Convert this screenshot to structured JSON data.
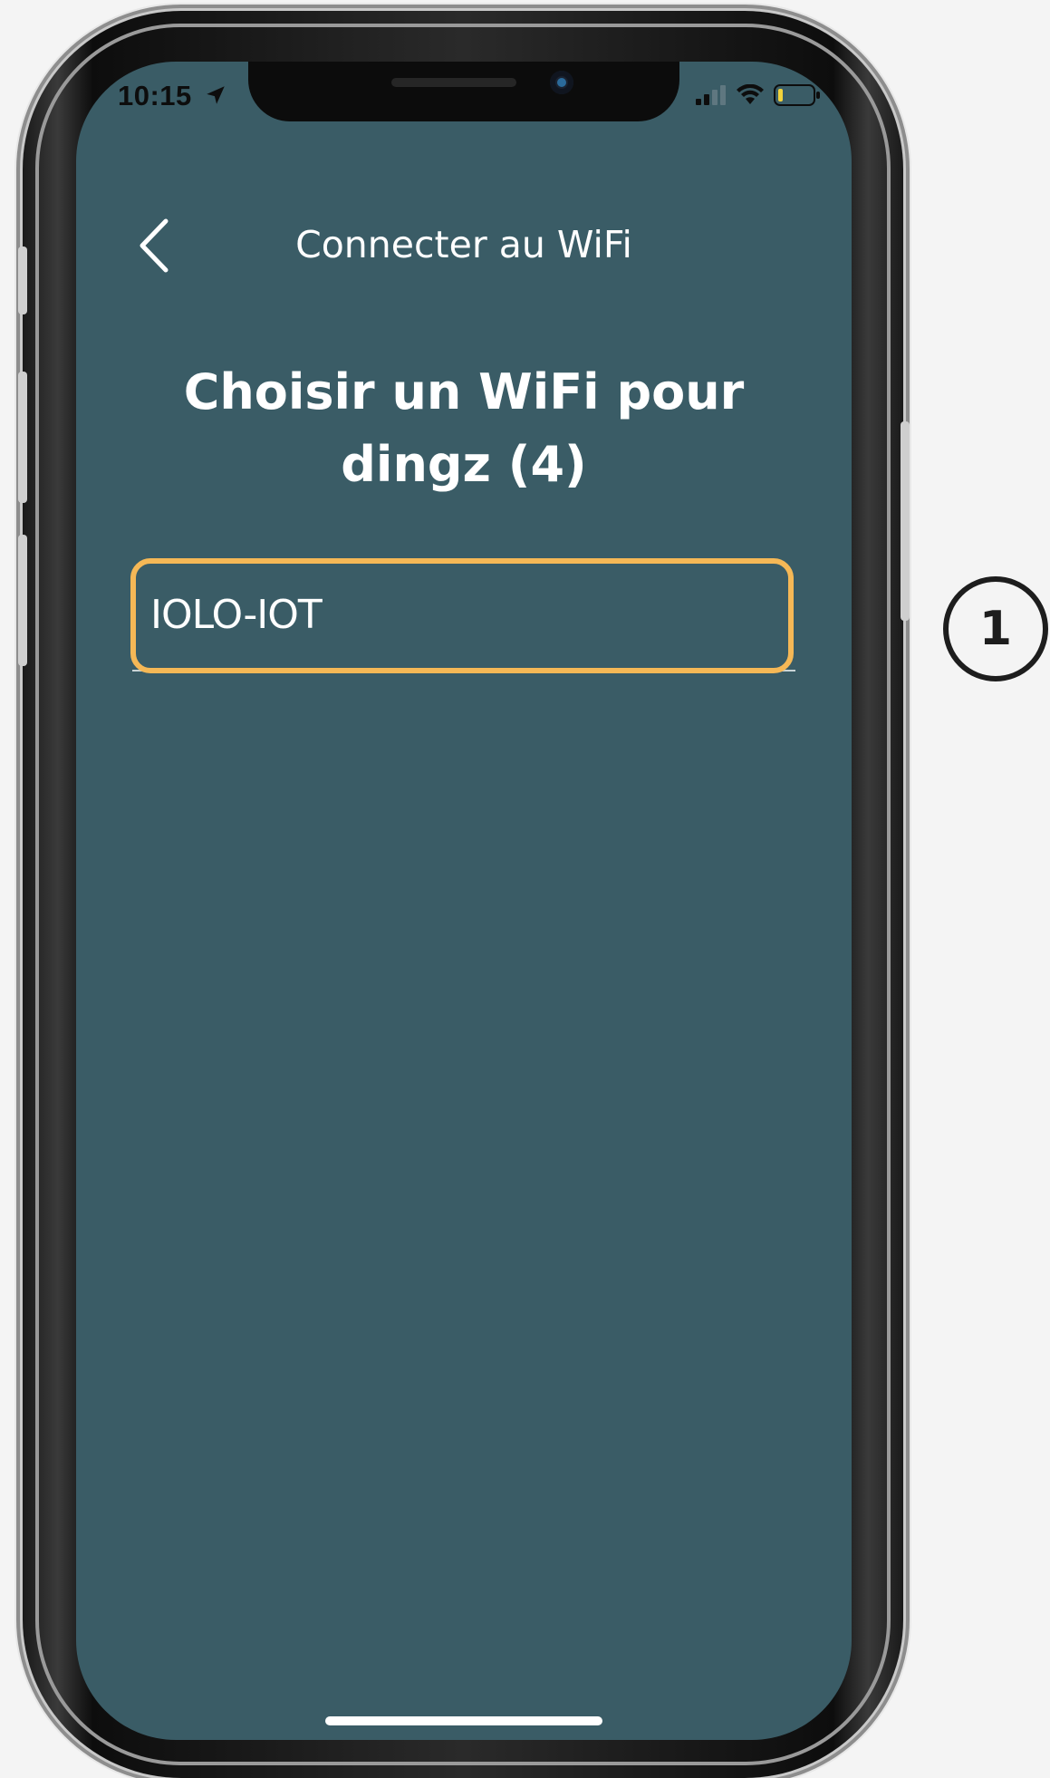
{
  "status_bar": {
    "time": "10:15",
    "location_icon": "location-arrow-icon",
    "signal_icon": "cellular-signal-icon",
    "wifi_icon": "wifi-icon",
    "battery_icon": "battery-low-icon",
    "battery_level": 0.15
  },
  "header": {
    "back_icon": "chevron-left-icon",
    "title": "Connecter au WiFi"
  },
  "main": {
    "heading": "Choisir un WiFi pour dingz (4)",
    "networks": [
      {
        "name": "IOLO-IOT"
      }
    ]
  },
  "annotation": {
    "step_number": "1",
    "highlight_color": "#f5b856"
  },
  "colors": {
    "screen_background": "#3a5c66",
    "text": "#ffffff",
    "page_background": "#f4f4f4"
  }
}
